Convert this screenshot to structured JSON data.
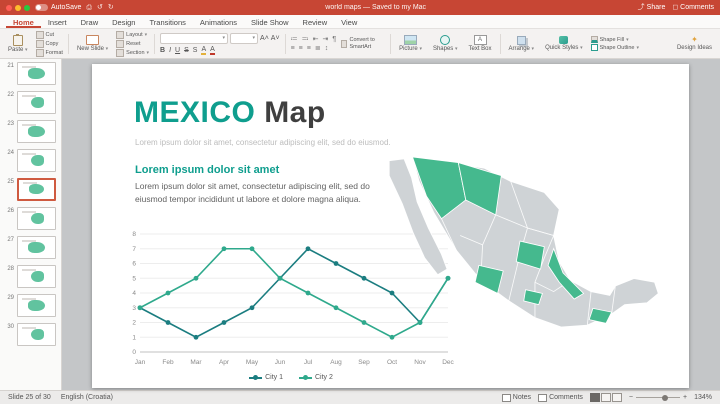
{
  "colors": {
    "titlebar": "#c74634",
    "accent": "#0f9e8e",
    "map_base": "#cfd3d6",
    "map_accent": "#45b98e",
    "selection": "#cf5a40"
  },
  "titlebar": {
    "autosave_label": "AutoSave",
    "title": "world maps — Saved to my Mac",
    "share_label": "Share",
    "comments_label": "Comments"
  },
  "ribbon": {
    "tabs": [
      {
        "label": "Home",
        "active": true
      },
      {
        "label": "Insert",
        "active": false
      },
      {
        "label": "Draw",
        "active": false
      },
      {
        "label": "Design",
        "active": false
      },
      {
        "label": "Transitions",
        "active": false
      },
      {
        "label": "Animations",
        "active": false
      },
      {
        "label": "Slide Show",
        "active": false
      },
      {
        "label": "Review",
        "active": false
      },
      {
        "label": "View",
        "active": false
      }
    ],
    "paste": "Paste",
    "cut": "Cut",
    "copy": "Copy",
    "format": "Format",
    "new_slide": "New Slide",
    "layout": "Layout",
    "reset": "Reset",
    "section": "Section",
    "convert_smartart": "Convert to SmartArt",
    "picture": "Picture",
    "shapes": "Shapes",
    "text_box": "Text Box",
    "arrange": "Arrange",
    "quick_styles": "Quick Styles",
    "shape_fill": "Shape Fill",
    "shape_outline": "Shape Outline",
    "design_ideas": "Design Ideas"
  },
  "thumbnails": {
    "selected": 25,
    "slides": [
      21,
      22,
      23,
      24,
      25,
      26,
      27,
      28,
      29,
      30
    ]
  },
  "slide": {
    "title_accent": "MEXICO",
    "title_rest": " Map",
    "subtitle": "Lorem ipsum dolor sit amet, consectetur adipiscing elit, sed do eiusmod.",
    "section_heading": "Lorem ipsum dolor sit amet",
    "body": "Lorem ipsum dolor sit amet, consectetur adipiscing elit, sed do eiusmod tempor incididunt ut labore et dolore magna aliqua."
  },
  "chart_data": {
    "type": "line",
    "title": "",
    "x": [
      "Jan",
      "Feb",
      "Mar",
      "Apr",
      "May",
      "Jun",
      "Jul",
      "Aug",
      "Sep",
      "Oct",
      "Nov",
      "Dec"
    ],
    "series": [
      {
        "name": "City 1",
        "color": "#1b7d80",
        "values": [
          3,
          2,
          1,
          2,
          3,
          5,
          7,
          6,
          5,
          4,
          2,
          5
        ]
      },
      {
        "name": "City 2",
        "color": "#2fa98c",
        "values": [
          3,
          4,
          5,
          7,
          7,
          5,
          4,
          3,
          2,
          1,
          2,
          5
        ]
      }
    ],
    "ylim": [
      0,
      8
    ],
    "yticks": [
      0,
      1,
      2,
      3,
      4,
      5,
      6,
      7,
      8
    ],
    "grid": "horizontal-light",
    "legend_position": "bottom"
  },
  "statusbar": {
    "slide_label": "Slide 25 of 30",
    "language": "English (Croatia)",
    "notes_label": "Notes",
    "comments_label": "Comments",
    "zoom": "134%"
  }
}
